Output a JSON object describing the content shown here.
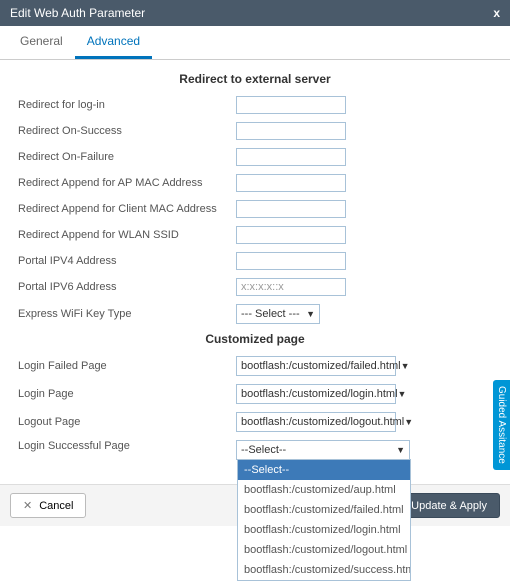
{
  "modal": {
    "title": "Edit Web Auth Parameter",
    "close": "x"
  },
  "tabs": {
    "general": "General",
    "advanced": "Advanced"
  },
  "sections": {
    "redirect_title": "Redirect to external server",
    "customized_title": "Customized page"
  },
  "fields": {
    "redirect_login": "Redirect for log-in",
    "redirect_on_success": "Redirect On-Success",
    "redirect_on_failure": "Redirect On-Failure",
    "redirect_append_ap_mac": "Redirect Append for AP MAC Address",
    "redirect_append_client_mac": "Redirect Append for Client MAC Address",
    "redirect_append_wlan_ssid": "Redirect Append for WLAN SSID",
    "portal_ipv4": "Portal IPV4 Address",
    "portal_ipv6": "Portal IPV6 Address",
    "portal_ipv6_value": "x:x:x:x::x",
    "express_wifi_key": "Express WiFi Key Type",
    "express_wifi_key_value": "--- Select ---",
    "login_failed_page": "Login Failed Page",
    "login_failed_value": "bootflash:/customized/failed.html",
    "login_page": "Login Page",
    "login_value": "bootflash:/customized/login.html",
    "logout_page": "Logout Page",
    "logout_value": "bootflash:/customized/logout.html",
    "login_success_page": "Login Successful Page",
    "login_success_value": "--Select--"
  },
  "dropdown_options": [
    "--Select--",
    "bootflash:/customized/aup.html",
    "bootflash:/customized/failed.html",
    "bootflash:/customized/login.html",
    "bootflash:/customized/logout.html",
    "bootflash:/customized/success.html"
  ],
  "footer": {
    "cancel": "Cancel",
    "apply": "Update & Apply"
  },
  "side_tab": "Guided Assitance"
}
